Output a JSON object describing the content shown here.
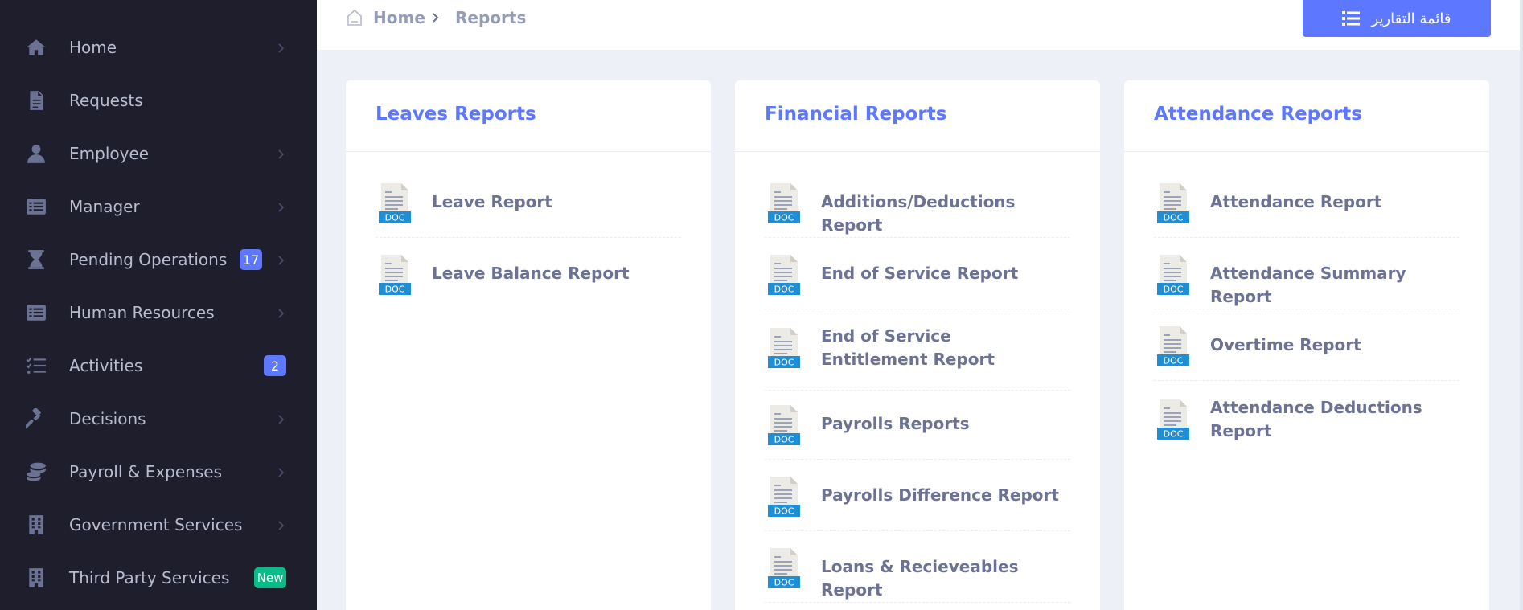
{
  "sidebar": {
    "items": [
      {
        "label": "Home",
        "icon": "home-icon",
        "chevron": true
      },
      {
        "label": "Requests",
        "icon": "file-icon",
        "chevron": false
      },
      {
        "label": "Employee",
        "icon": "user-icon",
        "chevron": true
      },
      {
        "label": "Manager",
        "icon": "list-icon",
        "chevron": true
      },
      {
        "label": "Pending Operations",
        "icon": "hourglass-icon",
        "chevron": true,
        "badge": "17"
      },
      {
        "label": "Human Resources",
        "icon": "list-icon",
        "chevron": true
      },
      {
        "label": "Activities",
        "icon": "tasks-icon",
        "chevron": false,
        "badge": "2"
      },
      {
        "label": "Decisions",
        "icon": "gavel-icon",
        "chevron": true
      },
      {
        "label": "Payroll & Expenses",
        "icon": "coins-icon",
        "chevron": true
      },
      {
        "label": "Government Services",
        "icon": "building-icon",
        "chevron": true
      },
      {
        "label": "Third Party Services",
        "icon": "building-icon",
        "chevron": false,
        "badge": "New"
      }
    ]
  },
  "header": {
    "breadcrumb_home": "Home",
    "breadcrumb_current": "Reports",
    "reports_button_label": "قائمة التقارير"
  },
  "cards": [
    {
      "title": "Leaves Reports",
      "reports": [
        "Leave Report",
        "Leave Balance Report"
      ]
    },
    {
      "title": "Financial Reports",
      "reports": [
        "Additions/Deductions Report",
        "End of Service Report",
        "End of Service Entitlement Report",
        "Payrolls Reports",
        "Payrolls Difference Report",
        "Loans & Recieveables Report"
      ]
    },
    {
      "title": "Attendance Reports",
      "reports": [
        "Attendance Report",
        "Attendance Summary Report",
        "Overtime Report",
        "Attendance Deductions Report"
      ]
    }
  ],
  "doc_icon_label": "DOC",
  "colors": {
    "sidebar_bg": "#1e1e2d",
    "accent": "#5d78ff",
    "badge_green": "#0abb87",
    "page_bg": "#eef0f8",
    "doc_blue": "#1e8fd6"
  }
}
